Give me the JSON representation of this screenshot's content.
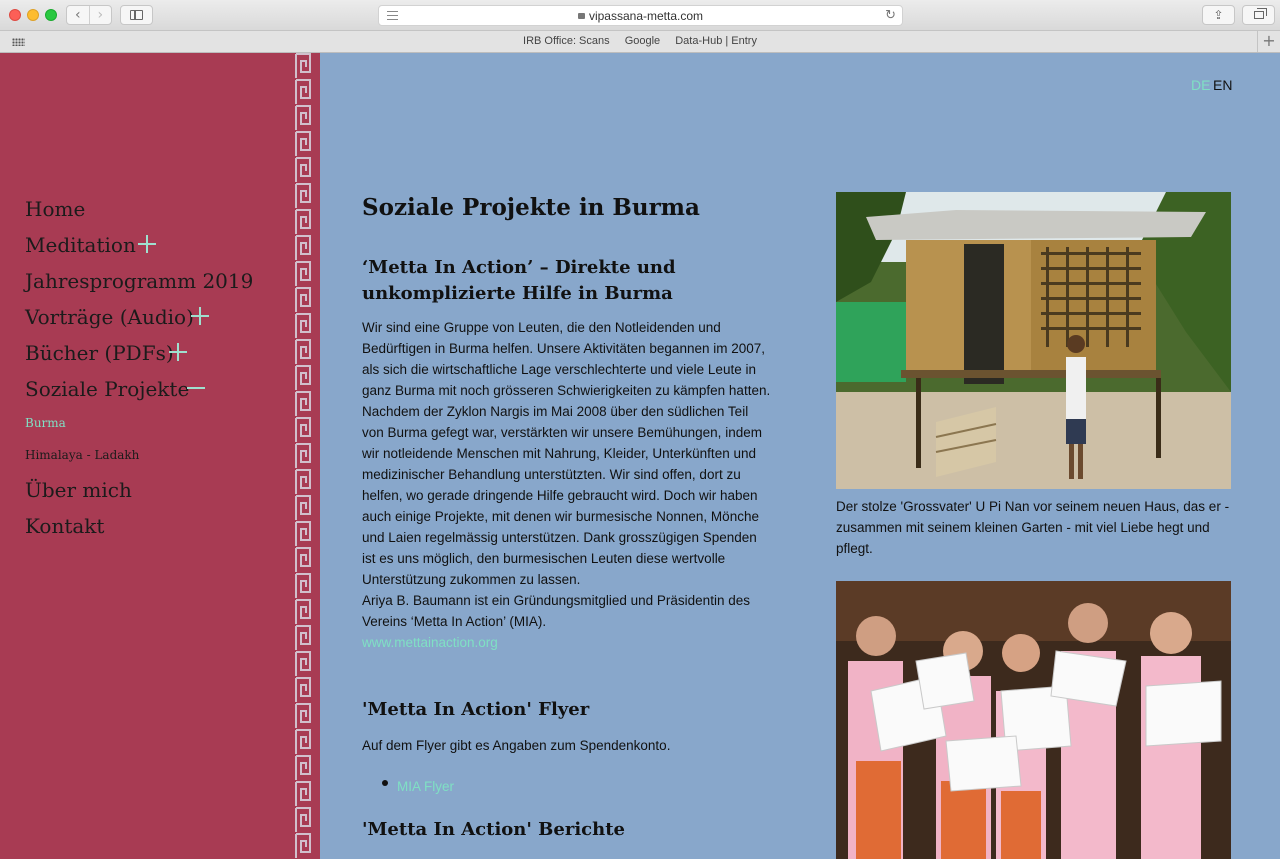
{
  "browser": {
    "url": "vipassana-metta.com",
    "favorites": [
      "IRB Office: Scans",
      "Google",
      "Data-Hub | Entry"
    ],
    "back_glyph": "‹",
    "forward_glyph": "›",
    "reload_glyph": "↻",
    "new_tab_glyph": "+",
    "share_glyph": "⇪"
  },
  "lang": {
    "de": "DE",
    "en": "EN"
  },
  "nav": {
    "items": [
      {
        "label": "Home"
      },
      {
        "label": "Meditation",
        "toggle": "plus"
      },
      {
        "label": "Jahresprogramm 2019"
      },
      {
        "label": "Vorträge (Audio)",
        "toggle": "plus"
      },
      {
        "label": "Bücher (PDFs)",
        "toggle": "plus"
      },
      {
        "label": "Soziale Projekte",
        "toggle": "minus"
      },
      {
        "label": "Burma",
        "sub": true,
        "active": true
      },
      {
        "label": "Himalaya - Ladakh",
        "sub": true
      },
      {
        "label": "Über mich"
      },
      {
        "label": "Kontakt"
      }
    ]
  },
  "content": {
    "title": "Soziale Projekte in Burma",
    "section1_heading": "‘Metta In Action’ – Direkte und unkomplizierte Hilfe in Burma",
    "section1_body": "Wir sind eine Gruppe von Leuten, die den Notleidenden und Bedürftigen in Burma helfen. Unsere Aktivitäten begannen im 2007, als sich die wirtschaftliche Lage verschlechterte und viele Leute in ganz Burma mit noch grösseren Schwierigkeiten zu kämpfen hatten. Nachdem der Zyklon Nargis im Mai 2008 über den südlichen Teil von Burma gefegt war, verstärkten wir unsere Bemühungen, indem wir notleidende Menschen mit Nahrung, Kleider, Unterkünften und medizinischer Behandlung unterstützten. Wir sind offen, dort zu helfen, wo gerade dringende Hilfe gebraucht wird. Doch wir haben auch einige Projekte, mit denen wir burmesische Nonnen, Mönche und Laien regelmässig unterstützen. Dank grosszügigen Spenden ist es uns möglich, den burmesischen Leuten diese wertvolle Unterstützung zukommen zu lassen.",
    "section1_body2": "Ariya B. Baumann ist ein Gründungsmitglied und Präsidentin des Vereins ‘Metta In Action’ (MIA).",
    "section1_link": "www.mettainaction.org",
    "section2_heading": "'Metta In Action' Flyer",
    "section2_body": "Auf dem Flyer gibt es Angaben zum Spendenkonto.",
    "section2_link": "MIA Flyer",
    "section3_heading": "'Metta In Action' Berichte"
  },
  "photos": {
    "caption1": "Der stolze 'Grossvater' U Pi Nan vor seinem neuen Haus, das er - zusammen mit seinem kleinen Garten - mit viel Liebe hegt und pflegt."
  },
  "colors": {
    "sidebar_bg": "#a83b53",
    "content_bg": "#88a7cb",
    "accent": "#7fe0c4"
  }
}
